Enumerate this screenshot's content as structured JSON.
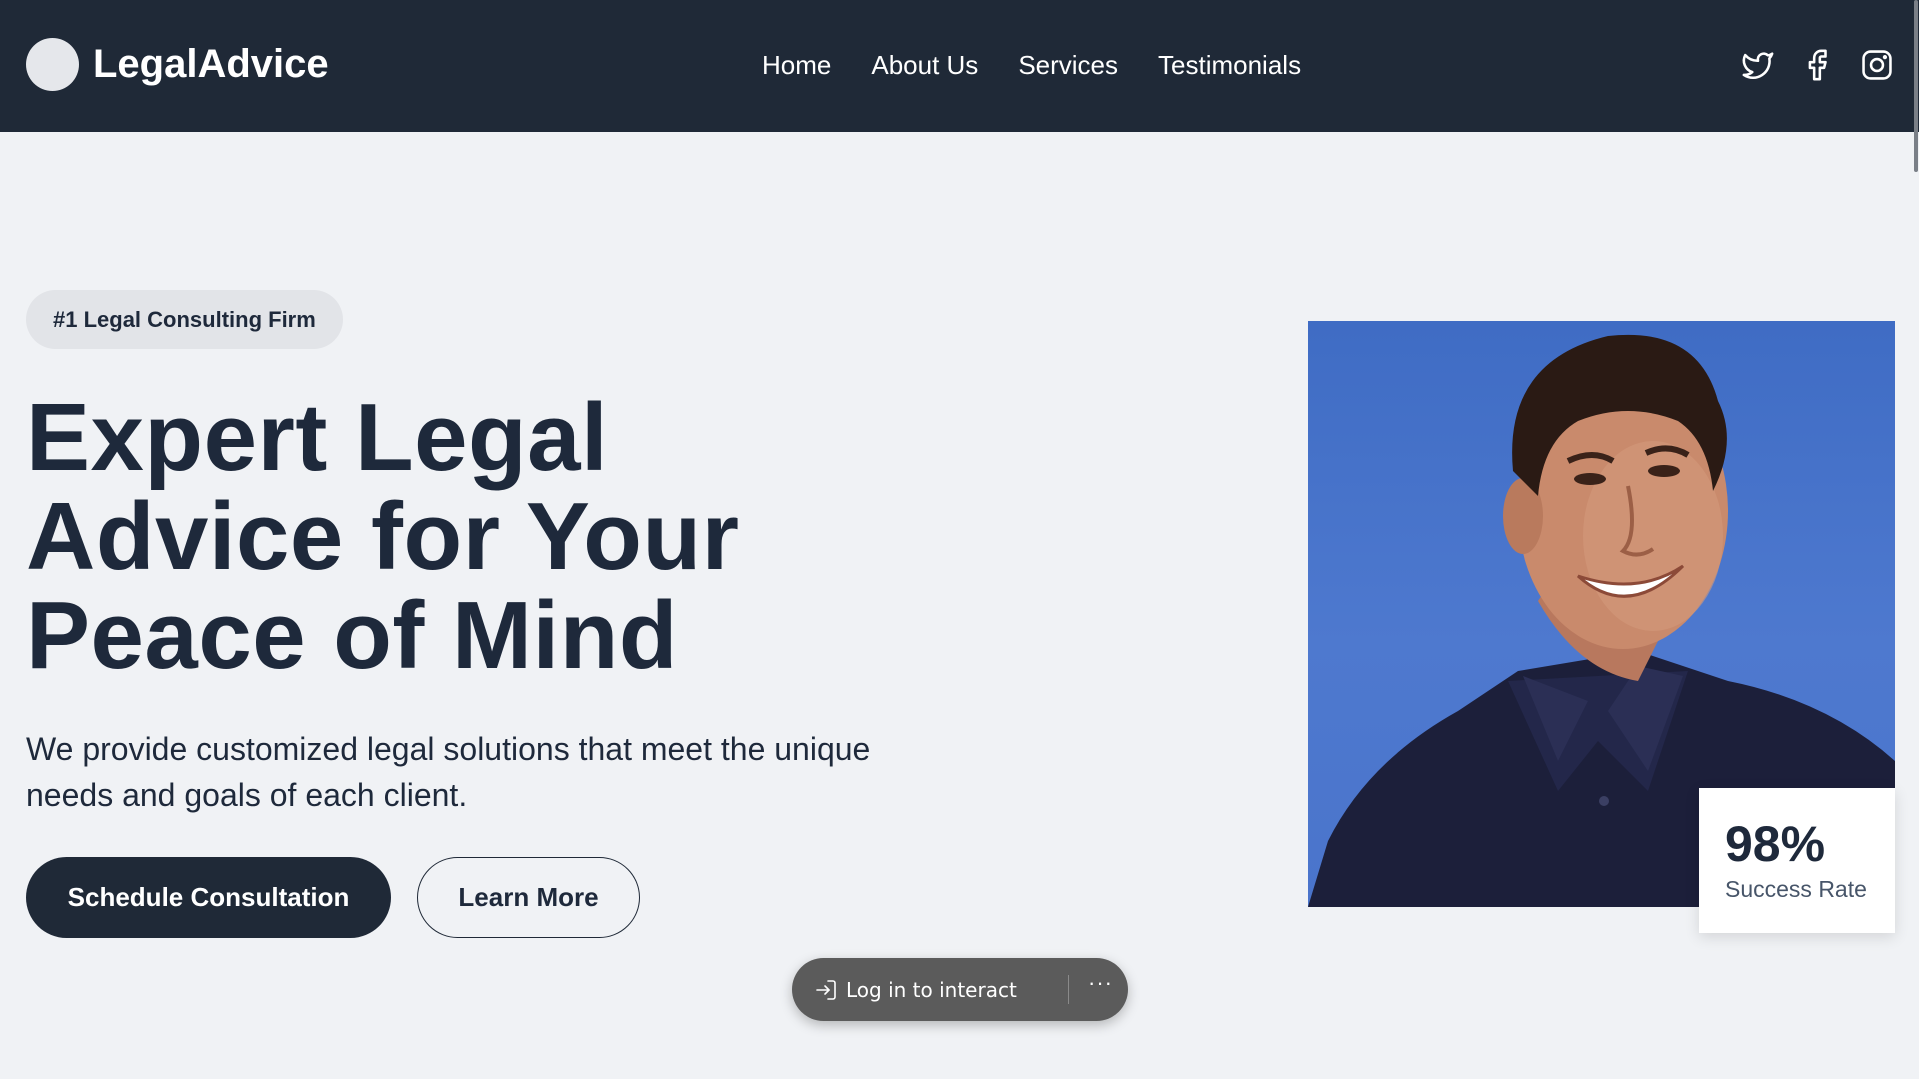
{
  "header": {
    "brand": "LegalAdvice",
    "nav": [
      "Home",
      "About Us",
      "Services",
      "Testimonials"
    ],
    "social_icons": [
      "twitter-icon",
      "facebook-icon",
      "instagram-icon"
    ]
  },
  "hero": {
    "badge": "#1 Legal Consulting Firm",
    "title_lines": [
      "Expert Legal",
      "Advice for Your",
      "Peace of Mind"
    ],
    "description": "We provide customized legal solutions that meet the unique needs and goals of each client.",
    "primary_button": "Schedule Consultation",
    "secondary_button": "Learn More"
  },
  "stat": {
    "value": "98%",
    "label": "Success Rate"
  },
  "overlay": {
    "login_text": "Log in to interact",
    "more": "···"
  },
  "colors": {
    "header_bg": "#1f2937",
    "page_bg": "#f0f2f5",
    "primary": "#1f2937",
    "photo_bg": "#4a74cb"
  }
}
